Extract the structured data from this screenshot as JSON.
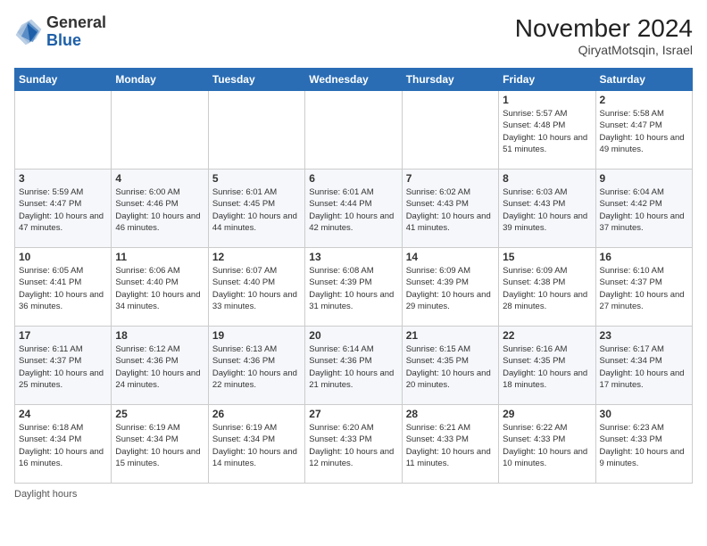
{
  "header": {
    "logo_general": "General",
    "logo_blue": "Blue",
    "month_title": "November 2024",
    "location": "QiryatMotsqin, Israel"
  },
  "weekdays": [
    "Sunday",
    "Monday",
    "Tuesday",
    "Wednesday",
    "Thursday",
    "Friday",
    "Saturday"
  ],
  "legend": {
    "daylight_hours": "Daylight hours"
  },
  "weeks": [
    [
      {
        "day": null
      },
      {
        "day": null
      },
      {
        "day": null
      },
      {
        "day": null
      },
      {
        "day": null
      },
      {
        "day": "1",
        "sunrise": "5:57 AM",
        "sunset": "4:48 PM",
        "daylight": "10 hours and 51 minutes."
      },
      {
        "day": "2",
        "sunrise": "5:58 AM",
        "sunset": "4:47 PM",
        "daylight": "10 hours and 49 minutes."
      }
    ],
    [
      {
        "day": "3",
        "sunrise": "5:59 AM",
        "sunset": "4:47 PM",
        "daylight": "10 hours and 47 minutes."
      },
      {
        "day": "4",
        "sunrise": "6:00 AM",
        "sunset": "4:46 PM",
        "daylight": "10 hours and 46 minutes."
      },
      {
        "day": "5",
        "sunrise": "6:01 AM",
        "sunset": "4:45 PM",
        "daylight": "10 hours and 44 minutes."
      },
      {
        "day": "6",
        "sunrise": "6:01 AM",
        "sunset": "4:44 PM",
        "daylight": "10 hours and 42 minutes."
      },
      {
        "day": "7",
        "sunrise": "6:02 AM",
        "sunset": "4:43 PM",
        "daylight": "10 hours and 41 minutes."
      },
      {
        "day": "8",
        "sunrise": "6:03 AM",
        "sunset": "4:43 PM",
        "daylight": "10 hours and 39 minutes."
      },
      {
        "day": "9",
        "sunrise": "6:04 AM",
        "sunset": "4:42 PM",
        "daylight": "10 hours and 37 minutes."
      }
    ],
    [
      {
        "day": "10",
        "sunrise": "6:05 AM",
        "sunset": "4:41 PM",
        "daylight": "10 hours and 36 minutes."
      },
      {
        "day": "11",
        "sunrise": "6:06 AM",
        "sunset": "4:40 PM",
        "daylight": "10 hours and 34 minutes."
      },
      {
        "day": "12",
        "sunrise": "6:07 AM",
        "sunset": "4:40 PM",
        "daylight": "10 hours and 33 minutes."
      },
      {
        "day": "13",
        "sunrise": "6:08 AM",
        "sunset": "4:39 PM",
        "daylight": "10 hours and 31 minutes."
      },
      {
        "day": "14",
        "sunrise": "6:09 AM",
        "sunset": "4:39 PM",
        "daylight": "10 hours and 29 minutes."
      },
      {
        "day": "15",
        "sunrise": "6:09 AM",
        "sunset": "4:38 PM",
        "daylight": "10 hours and 28 minutes."
      },
      {
        "day": "16",
        "sunrise": "6:10 AM",
        "sunset": "4:37 PM",
        "daylight": "10 hours and 27 minutes."
      }
    ],
    [
      {
        "day": "17",
        "sunrise": "6:11 AM",
        "sunset": "4:37 PM",
        "daylight": "10 hours and 25 minutes."
      },
      {
        "day": "18",
        "sunrise": "6:12 AM",
        "sunset": "4:36 PM",
        "daylight": "10 hours and 24 minutes."
      },
      {
        "day": "19",
        "sunrise": "6:13 AM",
        "sunset": "4:36 PM",
        "daylight": "10 hours and 22 minutes."
      },
      {
        "day": "20",
        "sunrise": "6:14 AM",
        "sunset": "4:36 PM",
        "daylight": "10 hours and 21 minutes."
      },
      {
        "day": "21",
        "sunrise": "6:15 AM",
        "sunset": "4:35 PM",
        "daylight": "10 hours and 20 minutes."
      },
      {
        "day": "22",
        "sunrise": "6:16 AM",
        "sunset": "4:35 PM",
        "daylight": "10 hours and 18 minutes."
      },
      {
        "day": "23",
        "sunrise": "6:17 AM",
        "sunset": "4:34 PM",
        "daylight": "10 hours and 17 minutes."
      }
    ],
    [
      {
        "day": "24",
        "sunrise": "6:18 AM",
        "sunset": "4:34 PM",
        "daylight": "10 hours and 16 minutes."
      },
      {
        "day": "25",
        "sunrise": "6:19 AM",
        "sunset": "4:34 PM",
        "daylight": "10 hours and 15 minutes."
      },
      {
        "day": "26",
        "sunrise": "6:19 AM",
        "sunset": "4:34 PM",
        "daylight": "10 hours and 14 minutes."
      },
      {
        "day": "27",
        "sunrise": "6:20 AM",
        "sunset": "4:33 PM",
        "daylight": "10 hours and 12 minutes."
      },
      {
        "day": "28",
        "sunrise": "6:21 AM",
        "sunset": "4:33 PM",
        "daylight": "10 hours and 11 minutes."
      },
      {
        "day": "29",
        "sunrise": "6:22 AM",
        "sunset": "4:33 PM",
        "daylight": "10 hours and 10 minutes."
      },
      {
        "day": "30",
        "sunrise": "6:23 AM",
        "sunset": "4:33 PM",
        "daylight": "10 hours and 9 minutes."
      }
    ]
  ]
}
